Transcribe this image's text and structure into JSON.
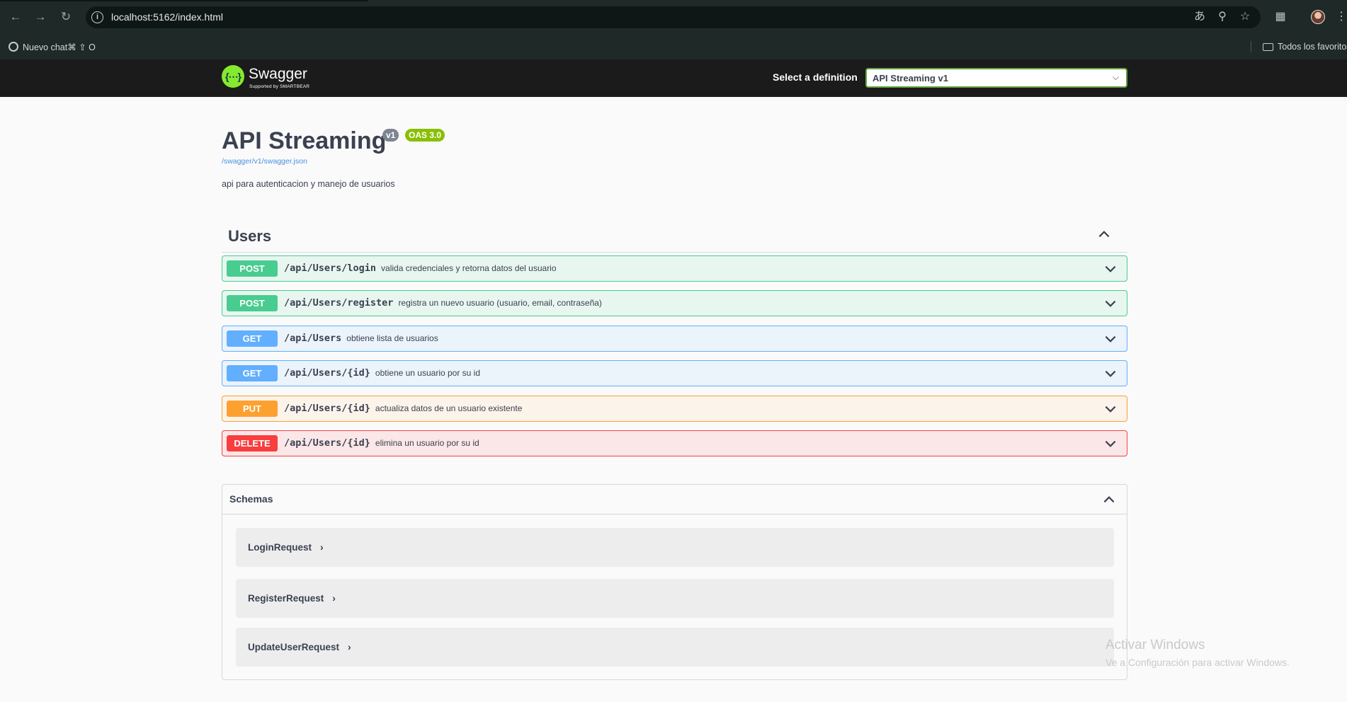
{
  "browser": {
    "url": "localhost:5162/index.html",
    "bookmarks": [
      {
        "label": "Nuevo chat⌘ ⇧ O",
        "icon": "gear-icon"
      },
      {
        "label": "Todos los favoritos",
        "icon": "folder-icon"
      }
    ]
  },
  "swagger": {
    "logo_text": "Swagger",
    "logo_sub": "Supported by SMARTBEAR",
    "select_label": "Select a definition",
    "selected_definition": "API Streaming v1",
    "accent_color": "#85ea2d"
  },
  "info": {
    "title": "API Streaming",
    "version": "v1",
    "oas": "OAS 3.0",
    "spec_url": "/swagger/v1/swagger.json",
    "description": "api para autenticacion y manejo de usuarios"
  },
  "tag": {
    "name": "Users",
    "expanded": true
  },
  "operations": [
    {
      "method": "POST",
      "path": "/api/Users/login",
      "summary": "valida credenciales y retorna datos del usuario",
      "color": "#49cc90"
    },
    {
      "method": "POST",
      "path": "/api/Users/register",
      "summary": "registra un nuevo usuario (usuario, email, contraseña)",
      "color": "#49cc90"
    },
    {
      "method": "GET",
      "path": "/api/Users",
      "summary": "obtiene lista de usuarios",
      "color": "#61affe"
    },
    {
      "method": "GET",
      "path": "/api/Users/{id}",
      "summary": "obtiene un usuario por su id",
      "color": "#61affe"
    },
    {
      "method": "PUT",
      "path": "/api/Users/{id}",
      "summary": "actualiza datos de un usuario existente",
      "color": "#fca130"
    },
    {
      "method": "DELETE",
      "path": "/api/Users/{id}",
      "summary": "elimina un usuario por su id",
      "color": "#f93e3e"
    }
  ],
  "schemas": {
    "title": "Schemas",
    "items": [
      {
        "name": "LoginRequest"
      },
      {
        "name": "RegisterRequest"
      },
      {
        "name": "UpdateUserRequest"
      }
    ]
  },
  "watermark": {
    "title": "Activar Windows",
    "subtitle": "Ve a Configuración para activar Windows."
  }
}
